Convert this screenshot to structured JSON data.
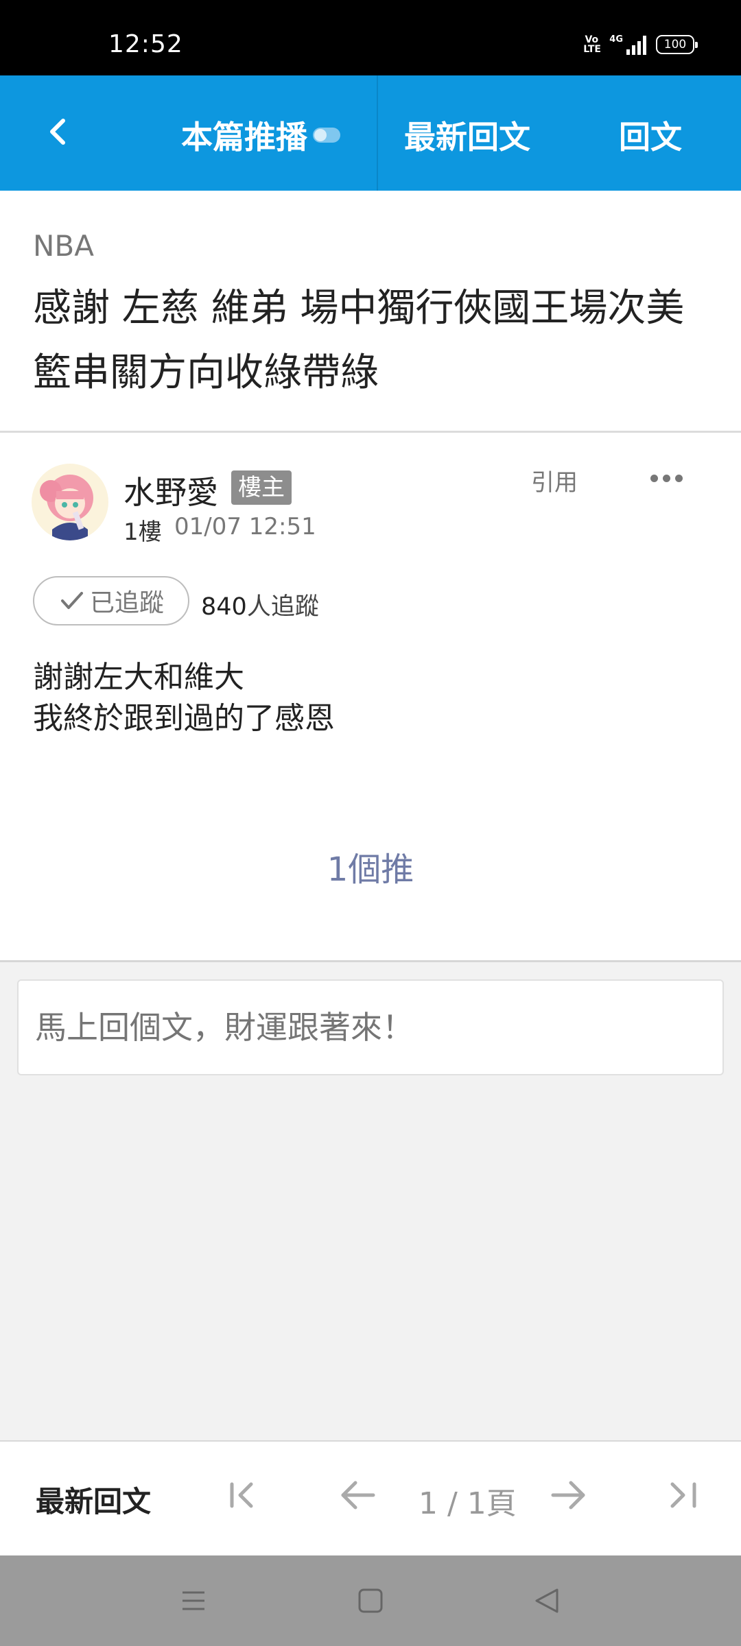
{
  "status_bar": {
    "time": "12:52",
    "volte": "Vo LTE",
    "network": "4G",
    "battery": "100"
  },
  "header": {
    "back_icon": "chevron-left-icon",
    "push_tab_label": "本篇推播",
    "latest_tab_label": "最新回文",
    "reply_tab_label": "回文",
    "background_color": "#0d97df"
  },
  "post": {
    "category": "NBA",
    "title": "感謝 左慈 維弟 場中獨行俠國王場次美籃串關方向收綠帶綠",
    "author": "水野愛",
    "op_badge": "樓主",
    "floor": "1樓",
    "timestamp": "01/07 12:51",
    "quote_label": "引用",
    "follow_label": "已追蹤",
    "followers_count": "840",
    "followers_suffix": "人追蹤",
    "content_line1": "謝謝左大和維大",
    "content_line2": "我終於跟到過的了感恩",
    "push_count": "1個推"
  },
  "reply_input": {
    "placeholder": "馬上回個文，財運跟著來！"
  },
  "bottom_bar": {
    "latest_label": "最新回文",
    "page_indicator": "1 / 1頁"
  }
}
